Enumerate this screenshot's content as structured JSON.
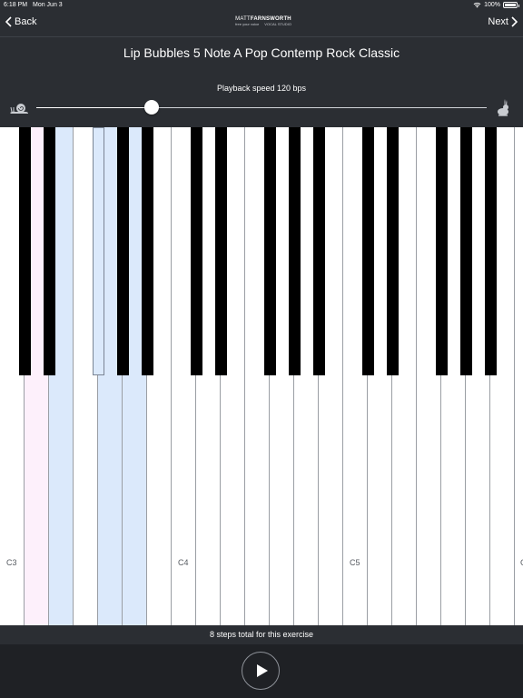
{
  "status": {
    "time": "6:18 PM",
    "date": "Mon Jun 3",
    "battery": "100%"
  },
  "nav": {
    "back_label": "Back",
    "next_label": "Next"
  },
  "logo": {
    "first": "MATT",
    "last": "FARNSWORTH",
    "tagline": "free your voice",
    "studio": "VOCAL STUDIO"
  },
  "exercise": {
    "title": "Lip Bubbles 5 Note A Pop Contemp Rock Classic"
  },
  "playback": {
    "label": "Playback speed 120 bps",
    "speed_fraction": 0.26,
    "slow_icon": "snail-icon",
    "fast_icon": "rabbit-icon"
  },
  "keyboard": {
    "labels": [
      "C3",
      "C4",
      "C5",
      "C"
    ],
    "white_keys": [
      "C3",
      "D3",
      "E3",
      "F3",
      "G3",
      "A3",
      "B3",
      "C4",
      "D4",
      "E4",
      "F4",
      "G4",
      "A4",
      "B4",
      "C5",
      "D5",
      "E5",
      "F5",
      "G5",
      "A5",
      "B5",
      "C6"
    ],
    "highlighted_pink": [
      "D3"
    ],
    "highlighted_blue": [
      "E3",
      "G3",
      "A3",
      "D#3"
    ],
    "colors": {
      "pink": "#fdf0fb",
      "blue": "#dbe9fb"
    }
  },
  "footer": {
    "steps_text": "8 steps total for this exercise",
    "play_icon": "play-icon"
  }
}
